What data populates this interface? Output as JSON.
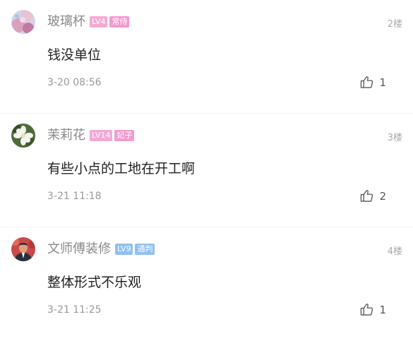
{
  "comments": [
    {
      "username": "玻璃杯",
      "level": "LV4",
      "level_color": "#f4a9d4",
      "title": "常侍",
      "title_color": "#f39ad0",
      "floor": "2楼",
      "content": "钱没单位",
      "time": "3-20 08:56",
      "likes": "1",
      "avatar_icon": "pink-blossom-avatar"
    },
    {
      "username": "茉莉花",
      "level": "LV14",
      "level_color": "#f4a9d4",
      "title": "妃子",
      "title_color": "#f39ad0",
      "floor": "3楼",
      "content": "有些小点的工地在开工啊",
      "time": "3-21 11:18",
      "likes": "2",
      "avatar_icon": "white-flower-avatar"
    },
    {
      "username": "文师傅装修",
      "level": "LV9",
      "level_color": "#8ec0f3",
      "title": "通判",
      "title_color": "#8ec0f3",
      "floor": "4楼",
      "content": "整体形式不乐观",
      "time": "3-21 11:25",
      "likes": "1",
      "avatar_icon": "man-portrait-avatar"
    }
  ]
}
